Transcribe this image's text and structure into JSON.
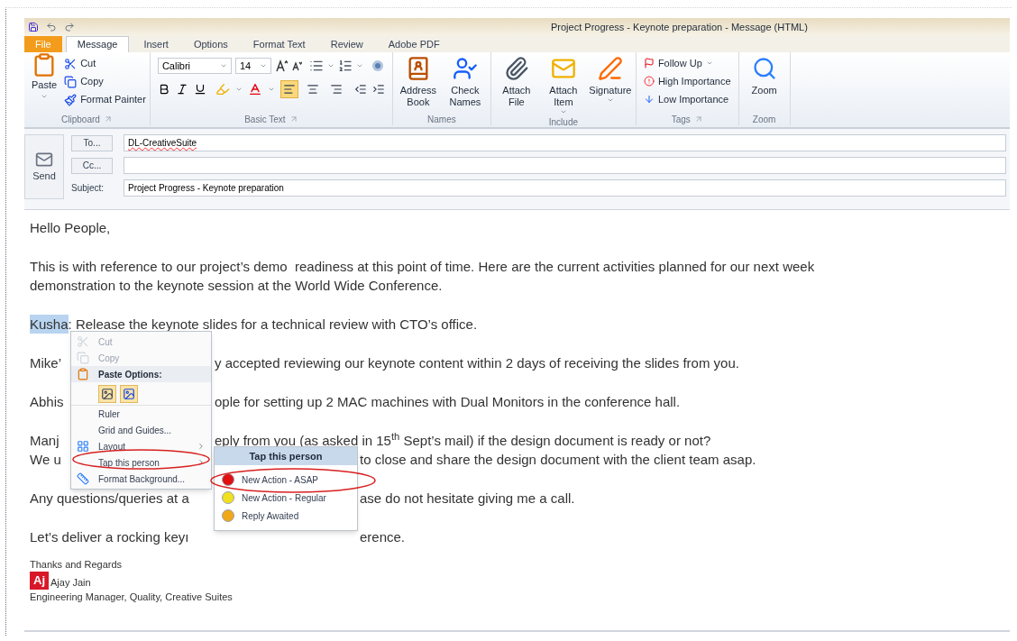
{
  "window": {
    "title": "Project Progress - Keynote preparation - Message (HTML)"
  },
  "tabs": [
    {
      "label": "File",
      "kind": "file",
      "selected": false
    },
    {
      "label": "Message",
      "kind": "tab",
      "selected": true
    },
    {
      "label": "Insert",
      "kind": "tab",
      "selected": false
    },
    {
      "label": "Options",
      "kind": "tab",
      "selected": false
    },
    {
      "label": "Format Text",
      "kind": "tab",
      "selected": false
    },
    {
      "label": "Review",
      "kind": "tab",
      "selected": false
    },
    {
      "label": "Adobe PDF",
      "kind": "tab",
      "selected": false
    }
  ],
  "ribbon": {
    "groups": [
      {
        "kind": "clipboard",
        "label": "Clipboard",
        "launcher": true,
        "big": "Paste",
        "items": [
          "Cut",
          "Copy",
          "Format Painter"
        ]
      },
      {
        "kind": "basic_text",
        "label": "Basic Text",
        "launcher": true,
        "font": "Calibri",
        "size": "14",
        "align": [
          {
            "selected": true
          },
          {
            "selected": false
          },
          {
            "selected": false
          }
        ]
      },
      {
        "kind": "large_buttons",
        "label": "Names",
        "launcher": false,
        "buttons": [
          {
            "label": "Address Book",
            "dropdown": false
          },
          {
            "label": "Check Names",
            "dropdown": false
          }
        ]
      },
      {
        "kind": "large_buttons",
        "label": "Include",
        "launcher": false,
        "buttons": [
          {
            "label": "Attach File",
            "dropdown": false
          },
          {
            "label": "Attach Item",
            "dropdown": true
          },
          {
            "label": "Signature",
            "dropdown": true
          }
        ]
      },
      {
        "kind": "small_list",
        "label": "Tags",
        "launcher": true,
        "items": [
          {
            "label": "Follow Up",
            "dropdown": true
          },
          {
            "label": "High Importance",
            "dropdown": false
          },
          {
            "label": "Low Importance",
            "dropdown": false
          }
        ]
      },
      {
        "kind": "large_buttons",
        "label": "Zoom",
        "launcher": false,
        "buttons": [
          {
            "label": "Zoom",
            "dropdown": false
          }
        ]
      }
    ]
  },
  "header": {
    "send": "Send",
    "to_button": "To...",
    "to_value": "DL-CreativeSuite",
    "cc_button": "Cc...",
    "subject_label": "Subject:",
    "subject_value": "Project Progress - Keynote preparation"
  },
  "body": {
    "paragraphs": [
      {
        "lines": [
          {
            "kind": "full",
            "text": "Hello People,"
          }
        ]
      },
      {
        "lines": [
          {
            "kind": "full",
            "text": "This is with reference to our project’s demo  readiness at this point of time. Here are the current activities planned for our next week"
          },
          {
            "kind": "full",
            "text": "demonstration to the keynote session at the World Wide Conference."
          }
        ]
      },
      {
        "lines": [
          {
            "kind": "selection",
            "highlight": "Kusha",
            "text": ": Release the keynote slides for a technical review with CTO’s office."
          }
        ]
      },
      {
        "lines": [
          {
            "kind": "menu_gap",
            "left": "Mike’",
            "right": "y accepted reviewing our keynote content within 2 days of receiving the slides from you."
          }
        ]
      },
      {
        "lines": [
          {
            "kind": "menu_gap",
            "left": "Abhis",
            "right": "ople for setting up 2 MAC machines with Dual Monitors in the conference hall."
          }
        ]
      },
      {
        "lines": [
          {
            "kind": "menu_gap",
            "left": "Manj",
            "right": "eply from you (as asked in 15$^{th}$ Sept’s mail) if the design document is ready or not?"
          },
          {
            "kind": "submenu_gap",
            "left": "We u",
            "right": "to close and share the design document with the client team asap."
          }
        ]
      },
      {
        "lines": [
          {
            "kind": "submenu_gap",
            "left": "Any questions/queries at a",
            "right": "ase do not hesitate giving me a call."
          }
        ]
      },
      {
        "lines": [
          {
            "kind": "submenu_gap",
            "left": "Let’s deliver a rocking keyı",
            "right": "erence."
          }
        ]
      }
    ],
    "signature": {
      "closing": "Thanks and Regards",
      "badge": "Aj",
      "name": "Ajay Jain",
      "role": "Engineering Manager, Quality, Creative Suites"
    }
  },
  "context_menu": {
    "items": [
      {
        "kind": "item",
        "label": "Cut",
        "disabled": true,
        "submenu": false
      },
      {
        "kind": "item",
        "label": "Copy",
        "disabled": true,
        "submenu": false
      },
      {
        "kind": "header",
        "label": "Paste Options:"
      },
      {
        "kind": "paste_icons"
      },
      {
        "kind": "item",
        "label": "Ruler",
        "disabled": false,
        "submenu": false
      },
      {
        "kind": "item",
        "label": "Grid and Guides...",
        "disabled": false,
        "submenu": false
      },
      {
        "kind": "item",
        "label": "Layout",
        "disabled": false,
        "submenu": true
      },
      {
        "kind": "item",
        "label": "Tap this person",
        "disabled": false,
        "submenu": true
      },
      {
        "kind": "item",
        "label": "Format Background...",
        "disabled": false,
        "submenu": false
      }
    ]
  },
  "submenu": {
    "title": "Tap this person",
    "items": [
      {
        "label": "New Action - ASAP",
        "color": "#e01010"
      },
      {
        "label": "New Action - Regular",
        "color": "#f0e020"
      },
      {
        "label": "Reply Awaited",
        "color": "#f0a818"
      }
    ]
  }
}
